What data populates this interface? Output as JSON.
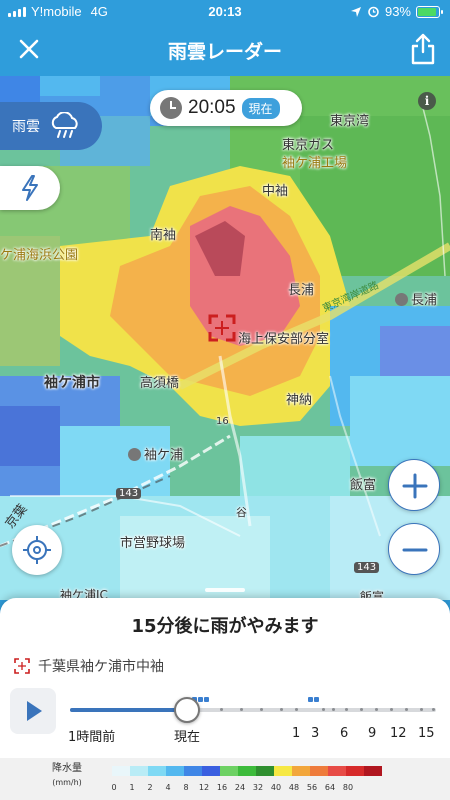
{
  "status_bar": {
    "carrier": "Y!mobile",
    "network": "4G",
    "time": "20:13",
    "battery": "93%"
  },
  "header": {
    "title": "雨雲レーダー"
  },
  "map": {
    "time_pill": {
      "time": "20:05",
      "badge": "現在"
    },
    "layer_button": {
      "label": "雨雲"
    },
    "info": "i",
    "labels": {
      "tokyo_wan": "東京湾",
      "tokyo_gas": "東京ガス",
      "sodegaura_plant": "袖ケ浦工場",
      "nakasode": "中袖",
      "minamisode": "南袖",
      "seaside_park": "ケ浦海浜公園",
      "nagaura": "長浦",
      "nagaura_station": "長浦",
      "coast_office": "海上保安部分室",
      "sodegaura_city": "袖ケ浦市",
      "takasuhashi": "高須橋",
      "kamino": "神納",
      "sodegaura_station": "袖ケ浦",
      "iitomi": "飯富",
      "tani": "谷",
      "stadium": "市営野球場",
      "expressway": "東京湾岸道路",
      "keiyo": "京葉",
      "route16": "16",
      "route143": "143",
      "route143b": "143",
      "sodegaura_ic": "袖ケ浦IC",
      "iitomi2": "飯富"
    }
  },
  "sheet": {
    "headline": "15分後に雨がやみます",
    "location": "千葉県袖ケ浦市中袖",
    "progress_fraction": 0.32,
    "ticks": [
      "1時間前",
      "現在",
      "1",
      "3",
      "6",
      "9",
      "12",
      "15"
    ]
  },
  "legend": {
    "title": "降水量",
    "unit": "(mm/h)",
    "values": [
      "0",
      "1",
      "2",
      "4",
      "8",
      "12",
      "16",
      "24",
      "32",
      "40",
      "48",
      "56",
      "64",
      "80"
    ],
    "colors": [
      "#e9f6fa",
      "#b9ecf6",
      "#7fd9f4",
      "#53b8ef",
      "#3f86e6",
      "#3a5fe0",
      "#6dd163",
      "#3dbb3b",
      "#2f8f2f",
      "#f6e843",
      "#f2a63b",
      "#ee7b3b",
      "#e74b46",
      "#d62a2a",
      "#b0161f"
    ]
  }
}
